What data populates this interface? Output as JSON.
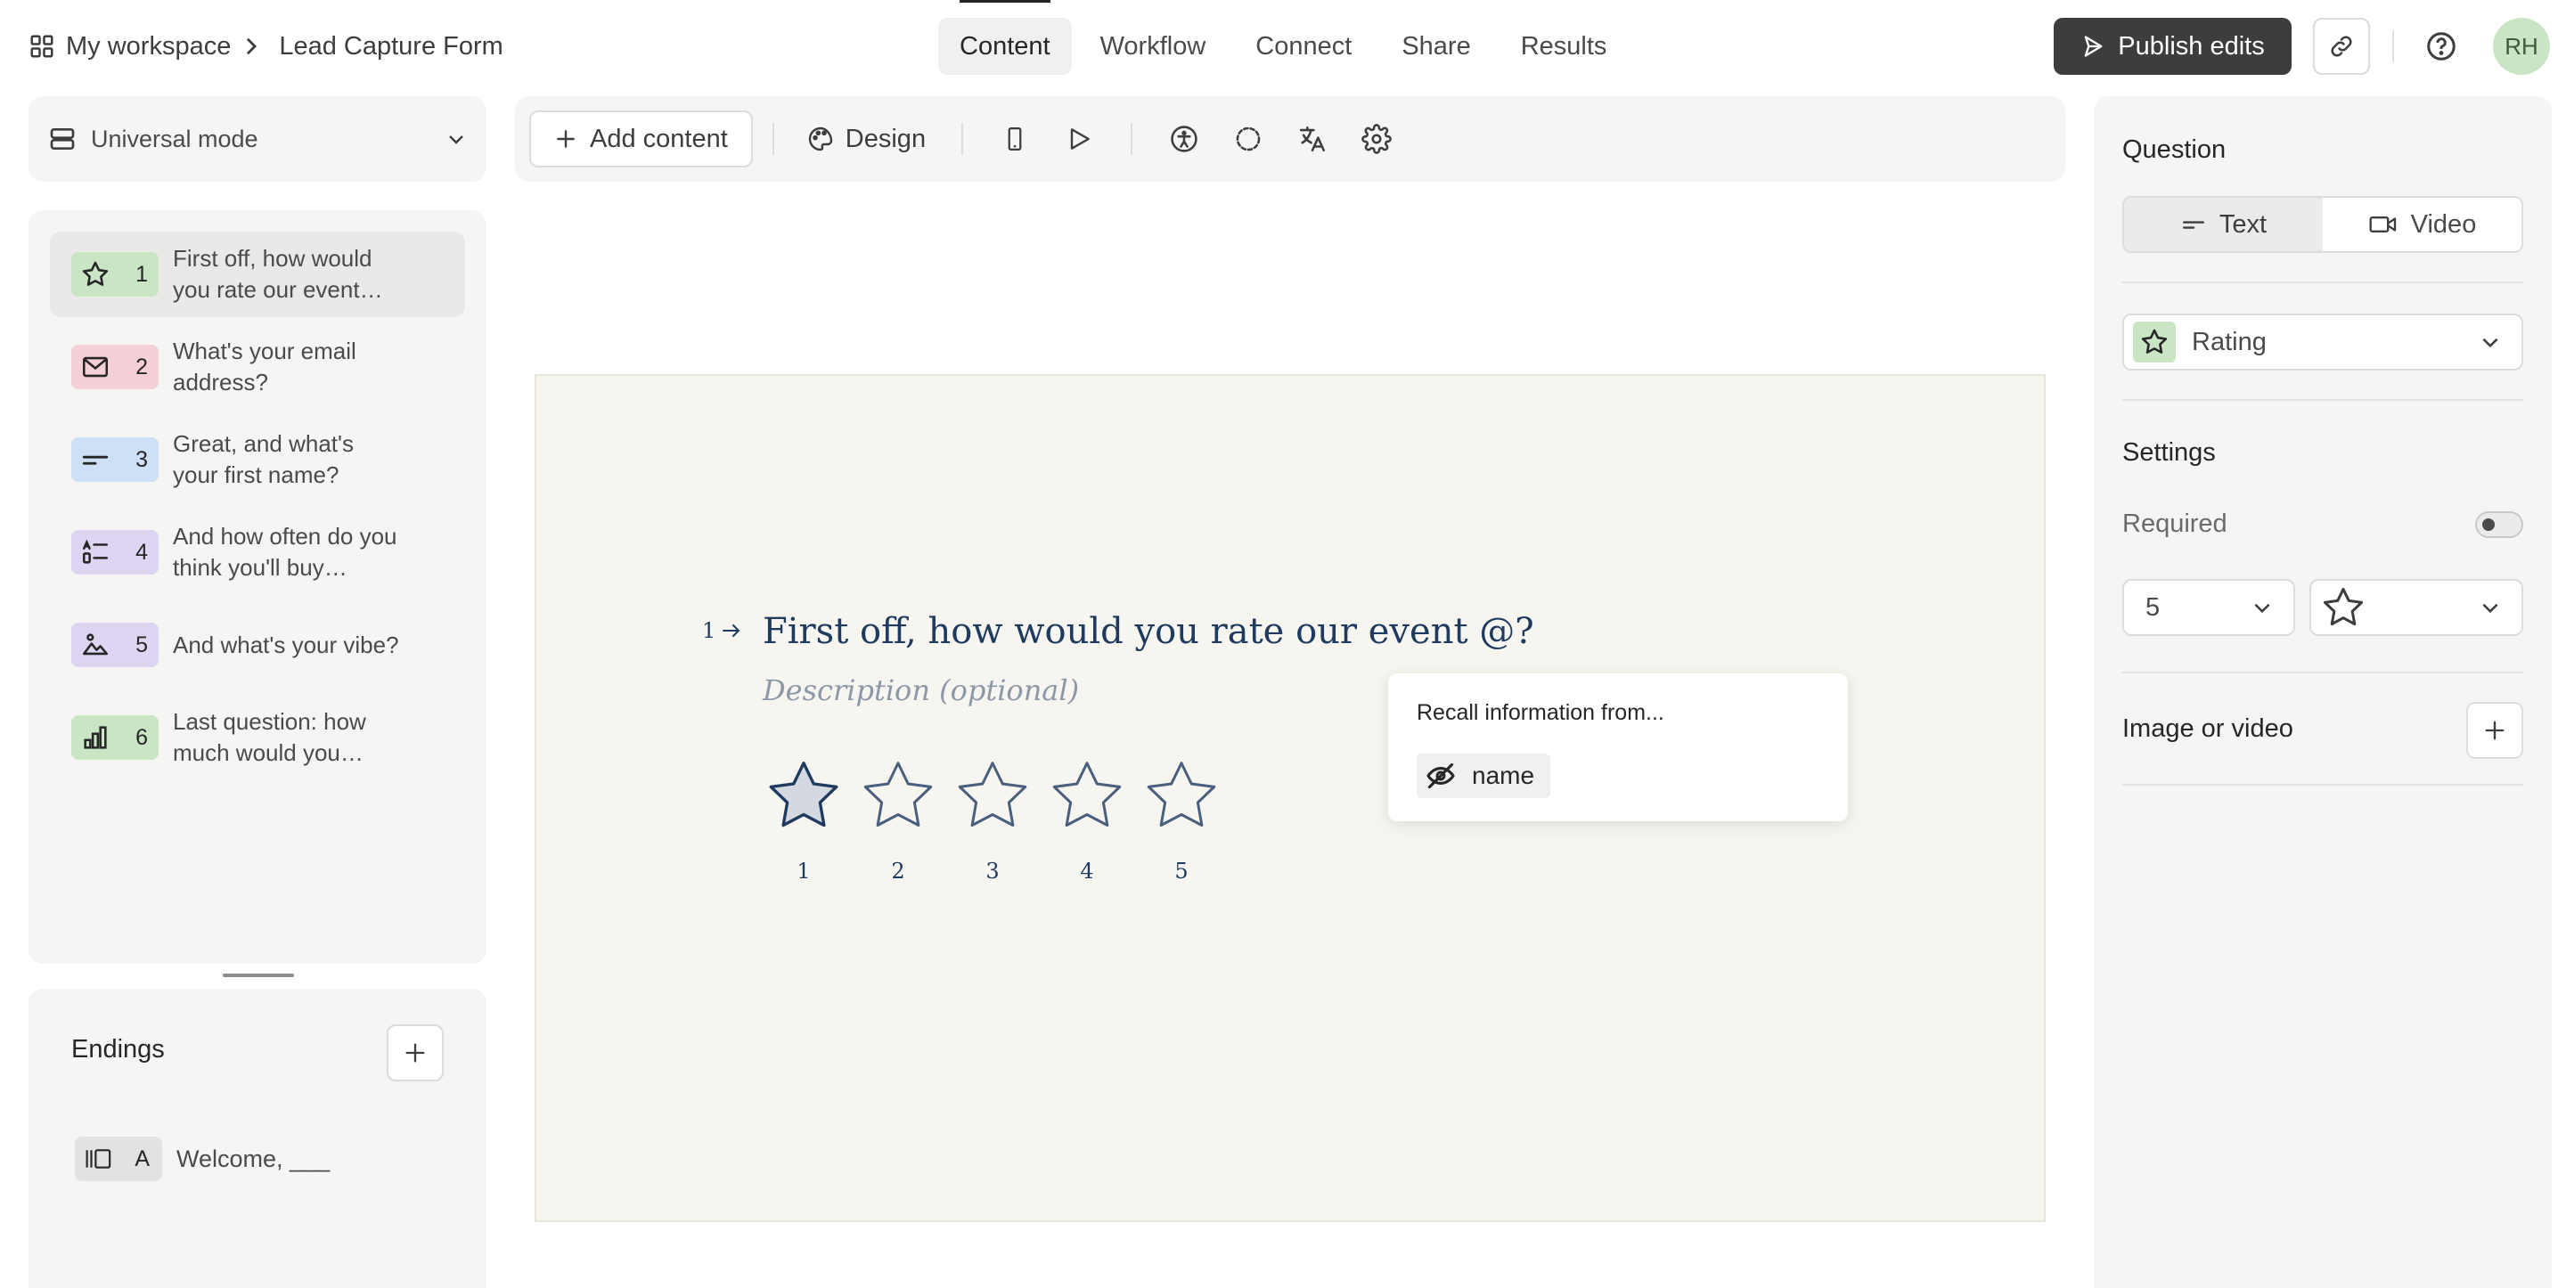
{
  "breadcrumb": {
    "workspace": "My workspace",
    "form": "Lead Capture Form"
  },
  "nav_tabs": [
    {
      "label": "Content",
      "active": true
    },
    {
      "label": "Workflow",
      "active": false
    },
    {
      "label": "Connect",
      "active": false
    },
    {
      "label": "Share",
      "active": false
    },
    {
      "label": "Results",
      "active": false
    }
  ],
  "header": {
    "publish_label": "Publish edits",
    "avatar_initials": "RH"
  },
  "mode": {
    "label": "Universal mode"
  },
  "questions": [
    {
      "number": "1",
      "text": "First off, how would you rate our event…",
      "icon": "star-icon",
      "color": "#c9e5c4",
      "active": true
    },
    {
      "number": "2",
      "text": "What's your email address?",
      "icon": "mail-icon",
      "color": "#f6d0d8",
      "active": false
    },
    {
      "number": "3",
      "text": "Great, and what's your first name?",
      "icon": "short-text-icon",
      "color": "#cde0f5",
      "active": false
    },
    {
      "number": "4",
      "text": "And how often do you think you'll buy…",
      "icon": "list-icon",
      "color": "#ddd5f2",
      "active": false
    },
    {
      "number": "5",
      "text": "And what's your vibe?",
      "icon": "picture-choice-icon",
      "color": "#ddd5f2",
      "active": false
    },
    {
      "number": "6",
      "text": "Last question: how much would you…",
      "icon": "bar-chart-icon",
      "color": "#c9e5c4",
      "active": false
    }
  ],
  "endings": {
    "title": "Endings",
    "items": [
      {
        "letter": "A",
        "text": "Welcome, ___",
        "icon": "ending-icon"
      }
    ]
  },
  "toolbar": {
    "add_content": "Add content",
    "design": "Design"
  },
  "canvas": {
    "question_number": "1",
    "question_title": "First off, how would you rate our event @?",
    "description_placeholder": "Description (optional)",
    "rating_labels": [
      "1",
      "2",
      "3",
      "4",
      "5"
    ],
    "rating_selected": 1,
    "recall": {
      "title": "Recall information from...",
      "chip": "name"
    }
  },
  "right_panel": {
    "question_label": "Question",
    "text_option": "Text",
    "video_option": "Video",
    "type_label": "Rating",
    "settings_label": "Settings",
    "required_label": "Required",
    "required_on": false,
    "steps_value": "5",
    "shape_icon": "star-icon",
    "media_label": "Image or video"
  },
  "colors": {
    "publish_bg": "#3d3d3f",
    "canvas_bg": "#f6f5f0",
    "question_text": "#1e3a5f",
    "avatar_bg": "#c9e5c4"
  }
}
